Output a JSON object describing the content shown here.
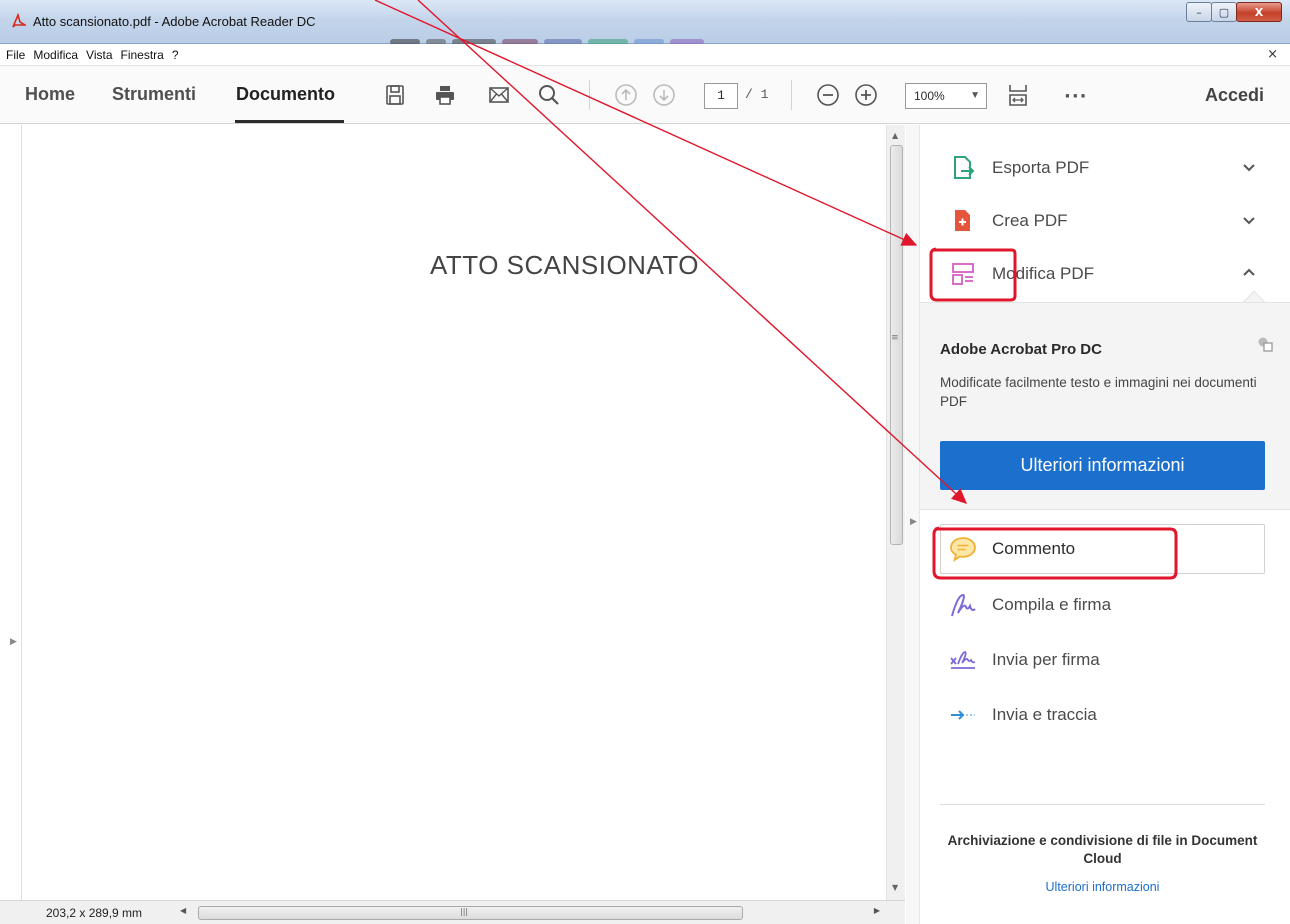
{
  "window": {
    "title": "Atto scansionato.pdf - Adobe Acrobat Reader DC",
    "controls": {
      "minimize": "–",
      "maximize": "▢",
      "close": "X"
    }
  },
  "menu": {
    "items": [
      "File",
      "Modifica",
      "Vista",
      "Finestra",
      "?"
    ],
    "close_doc": "×"
  },
  "toolbar": {
    "tabs": [
      "Home",
      "Strumenti",
      "Documento"
    ],
    "active_tab": "Documento",
    "page_current": "1",
    "page_total": "/ 1",
    "zoom": "100%",
    "more": "···",
    "sign_in": "Accedi"
  },
  "document": {
    "heading": "ATTO SCANSIONATO",
    "size": "203,2 x 289,9 mm"
  },
  "right_pane": {
    "tools_top": [
      {
        "label": "Esporta PDF",
        "icon": "export-pdf-icon",
        "color": "#2ea37a"
      },
      {
        "label": "Crea PDF",
        "icon": "create-pdf-icon",
        "color": "#e5553d"
      },
      {
        "label": "Modifica PDF",
        "icon": "edit-pdf-icon",
        "color": "#d65cc4"
      }
    ],
    "promo": {
      "title": "Adobe Acrobat Pro DC",
      "description": "Modificate facilmente testo e immagini nei documenti PDF",
      "button": "Ulteriori informazioni"
    },
    "tools_bottom": [
      {
        "label": "Commento",
        "icon": "comment-icon",
        "color": "#f2b134"
      },
      {
        "label": "Compila e firma",
        "icon": "fill-sign-icon",
        "color": "#7b6ad8"
      },
      {
        "label": "Invia per firma",
        "icon": "send-for-signature-icon",
        "color": "#7b6ad8"
      },
      {
        "label": "Invia e traccia",
        "icon": "send-track-icon",
        "color": "#2f8fd6"
      }
    ],
    "cloud": {
      "text": "Archiviazione e condivisione di file in Document Cloud",
      "link": "Ulteriori informazioni"
    }
  },
  "colors": {
    "accent_blue": "#1b6fcd",
    "annotation_red": "#e0162b"
  }
}
